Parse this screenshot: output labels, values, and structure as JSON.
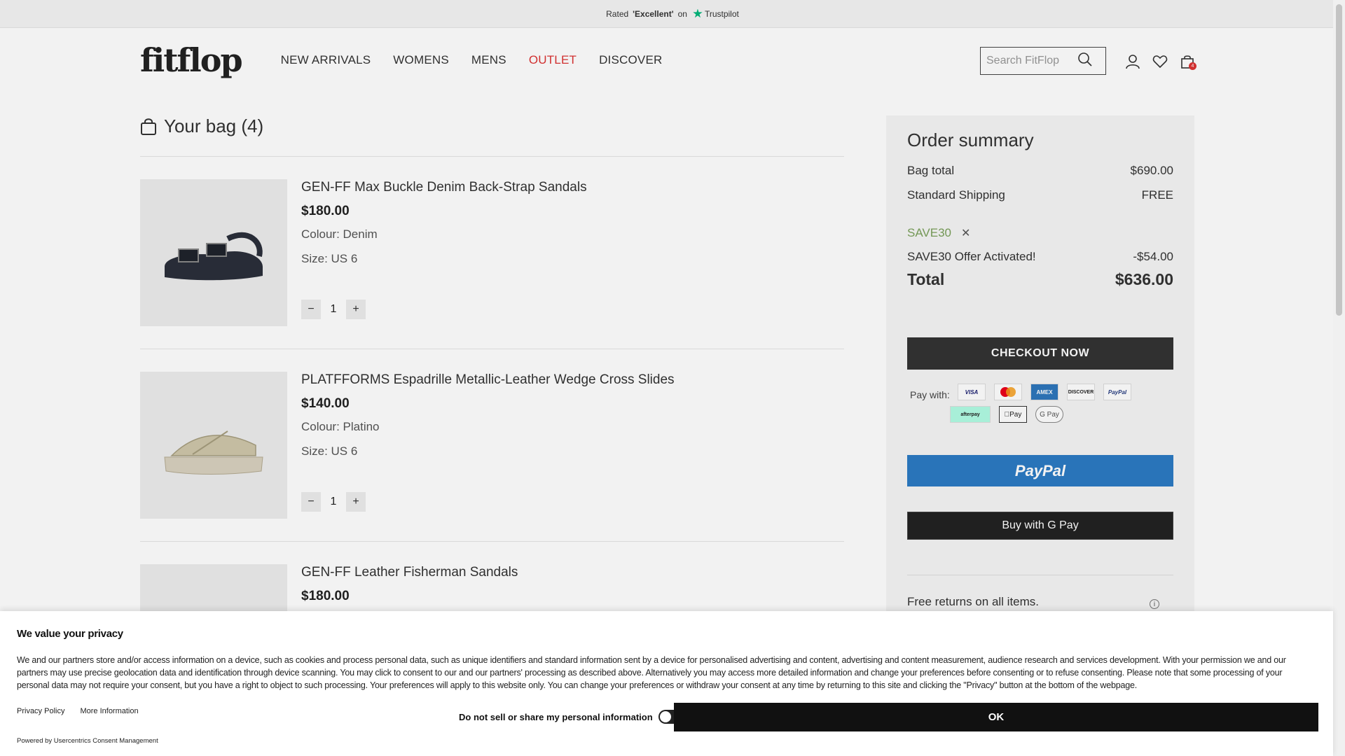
{
  "topbar": {
    "rated": "Rated",
    "excellent": "'Excellent'",
    "on": "on",
    "trustpilot": "Trustpilot"
  },
  "header": {
    "logo": "fitflop",
    "nav": [
      "NEW ARRIVALS",
      "WOMENS",
      "MENS",
      "OUTLET",
      "DISCOVER"
    ],
    "search_placeholder": "Search FitFlop",
    "bag_count": "4"
  },
  "bag": {
    "title": "Your bag (4)",
    "items": [
      {
        "name": "GEN-FF Max Buckle Denim Back-Strap Sandals",
        "price": "$180.00",
        "colour": "Colour: Denim",
        "size": "Size: US 6",
        "qty": "1"
      },
      {
        "name": "PLATFFORMS Espadrille Metallic-Leather Wedge Cross Slides",
        "price": "$140.00",
        "colour": "Colour: Platino",
        "size": "Size: US 6",
        "qty": "1"
      },
      {
        "name": "GEN-FF Leather Fisherman Sandals",
        "price": "$180.00"
      }
    ]
  },
  "summary": {
    "title": "Order summary",
    "bag_total_label": "Bag total",
    "bag_total": "$690.00",
    "shipping_label": "Standard Shipping",
    "shipping": "FREE",
    "promo_code": "SAVE30",
    "offer_label": "SAVE30 Offer Activated!",
    "offer": "-$54.00",
    "total_label": "Total",
    "total": "$636.00",
    "checkout": "CHECKOUT NOW",
    "pay_with": "Pay with:",
    "cards": [
      "VISA",
      "Mastercard",
      "AMEX",
      "DISCOVER",
      "PayPal"
    ],
    "cards2": [
      "afterpay",
      "Pay",
      "G Pay"
    ],
    "paypal": "PayPal",
    "gpay": "Buy with G Pay",
    "returns": "Free returns on all items."
  },
  "consent": {
    "title": "We value your privacy",
    "body": "We and our partners store and/or access information on a device, such as cookies and process personal data, such as unique identifiers and standard information sent by a device for personalised advertising and content, advertising and content measurement, audience research and services development. With your permission we and our partners may use precise geolocation data and identification through device scanning. You may click to consent to our and our partners' processing as described above. Alternatively you may access more detailed information and change your preferences before consenting or to refuse consenting. Please note that some processing of your personal data may not require your consent, but you have a right to object to such processing. Your preferences will apply to this website only. You can change your preferences or withdraw your consent at any time by returning to this site and clicking the \"Privacy\" button at the bottom of the webpage.",
    "privacy_policy": "Privacy Policy",
    "more_info": "More Information",
    "powered": "Powered by Usercentrics Consent Management",
    "dns": "Do not sell or share my personal information",
    "ok": "OK"
  },
  "colors": {
    "accent": "#d33333",
    "paypal": "#2c7bc3",
    "promo": "#7aa05a"
  }
}
